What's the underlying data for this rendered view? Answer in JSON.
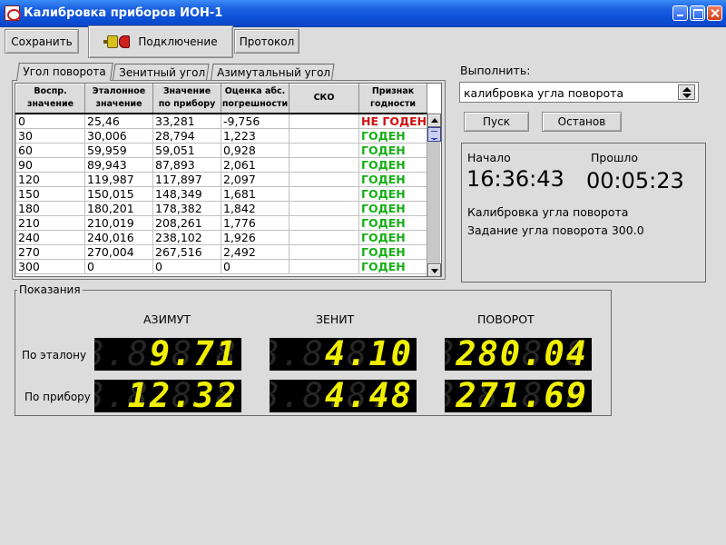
{
  "window": {
    "title": "Калибровка приборов ИОН-1"
  },
  "toolbar": {
    "save": "Сохранить",
    "connect": "Подключение",
    "protocol": "Протокол"
  },
  "tabs": [
    {
      "label": "Угол поворота",
      "active": true
    },
    {
      "label": "Зенитный угол",
      "active": false
    },
    {
      "label": "Азимутальный угол",
      "active": false
    }
  ],
  "table": {
    "columns": [
      [
        "Воспр.",
        "значение"
      ],
      [
        "Эталонное",
        "значение"
      ],
      [
        "Значение",
        "по прибору"
      ],
      [
        "Оценка абс.",
        "погрешности"
      ],
      [
        "СКО",
        ""
      ],
      [
        "Признак",
        "годности"
      ]
    ],
    "rows": [
      {
        "set": "0",
        "ref": "25,46",
        "dev": "33,281",
        "err": "-9,756",
        "sko": "",
        "status": "НЕ ГОДЕН",
        "ok": false
      },
      {
        "set": "30",
        "ref": "30,006",
        "dev": "28,794",
        "err": "1,223",
        "sko": "",
        "status": "ГОДЕН",
        "ok": true
      },
      {
        "set": "60",
        "ref": "59,959",
        "dev": "59,051",
        "err": "0,928",
        "sko": "",
        "status": "ГОДЕН",
        "ok": true
      },
      {
        "set": "90",
        "ref": "89,943",
        "dev": "87,893",
        "err": "2,061",
        "sko": "",
        "status": "ГОДЕН",
        "ok": true
      },
      {
        "set": "120",
        "ref": "119,987",
        "dev": "117,897",
        "err": "2,097",
        "sko": "",
        "status": "ГОДЕН",
        "ok": true
      },
      {
        "set": "150",
        "ref": "150,015",
        "dev": "148,349",
        "err": "1,681",
        "sko": "",
        "status": "ГОДЕН",
        "ok": true
      },
      {
        "set": "180",
        "ref": "180,201",
        "dev": "178,382",
        "err": "1,842",
        "sko": "",
        "status": "ГОДЕН",
        "ok": true
      },
      {
        "set": "210",
        "ref": "210,019",
        "dev": "208,261",
        "err": "1,776",
        "sko": "",
        "status": "ГОДЕН",
        "ok": true
      },
      {
        "set": "240",
        "ref": "240,016",
        "dev": "238,102",
        "err": "1,926",
        "sko": "",
        "status": "ГОДЕН",
        "ok": true
      },
      {
        "set": "270",
        "ref": "270,004",
        "dev": "267,516",
        "err": "2,492",
        "sko": "",
        "status": "ГОДЕН",
        "ok": true
      },
      {
        "set": "300",
        "ref": "0",
        "dev": "0",
        "err": "0",
        "sko": "",
        "status": "ГОДЕН",
        "ok": true
      }
    ]
  },
  "execute": {
    "label": "Выполнить:",
    "selected": "калибровка угла поворота",
    "start": "Пуск",
    "stop": "Останов"
  },
  "status": {
    "start_label": "Начало",
    "elapsed_label": "Прошло",
    "start_time": "16:36:43",
    "elapsed_time": "00:05:23",
    "line1": "Калибровка угла поворота",
    "line2": "Задание угла поворота 300.0"
  },
  "readings": {
    "legend": "Показания",
    "headers": {
      "azimuth": "АЗИМУТ",
      "zenith": "ЗЕНИТ",
      "rotation": "ПОВОРОТ"
    },
    "row_reference": "По эталону",
    "row_device": "По прибору",
    "reference": {
      "azimuth": "9.71",
      "zenith": "4.10",
      "rotation": "280.04"
    },
    "device": {
      "azimuth": "12.32",
      "zenith": "4.48",
      "rotation": "271.69"
    },
    "ghost": "8.8.8.8.8"
  },
  "colors": {
    "good": "#16b016",
    "bad": "#d01010",
    "lcd_on": "#f0f000",
    "title_bar": "#0c4fd6"
  }
}
